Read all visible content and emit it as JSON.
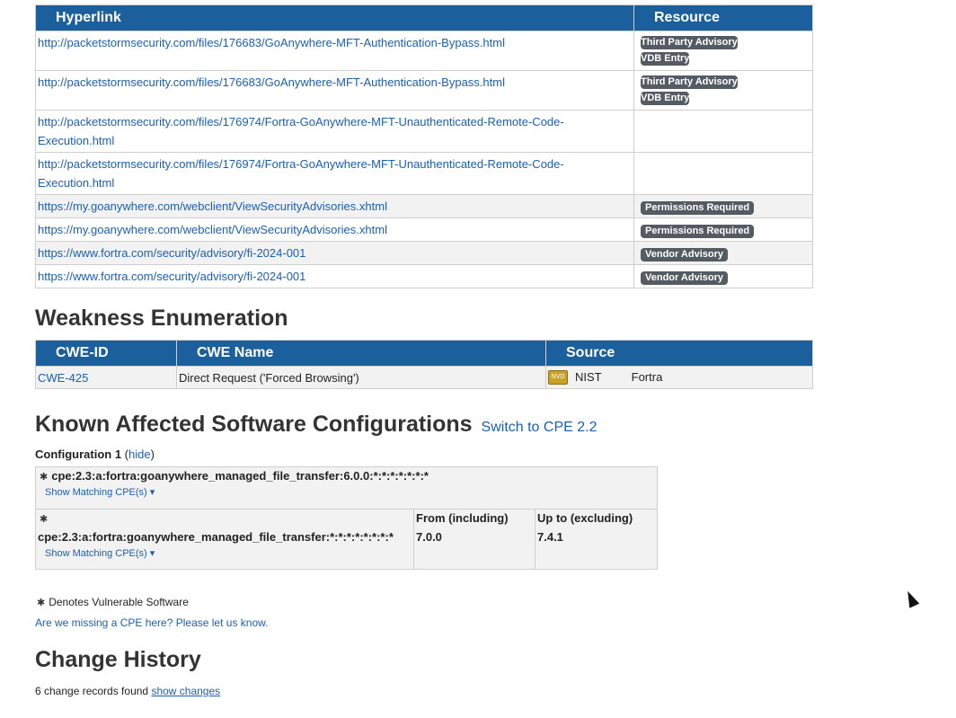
{
  "refs": {
    "col_hyperlink": "Hyperlink",
    "col_resource": "Resource",
    "rows": [
      {
        "url": "http://packetstormsecurity.com/files/176683/GoAnywhere-MFT-Authentication-Bypass.html",
        "badges": [
          "Third Party Advisory",
          "VDB Entry"
        ]
      },
      {
        "url": "http://packetstormsecurity.com/files/176683/GoAnywhere-MFT-Authentication-Bypass.html",
        "badges": [
          "Third Party Advisory",
          "VDB Entry"
        ]
      },
      {
        "url": "http://packetstormsecurity.com/files/176974/Fortra-GoAnywhere-MFT-Unauthenticated-Remote-Code-Execution.html",
        "badges": []
      },
      {
        "url": "http://packetstormsecurity.com/files/176974/Fortra-GoAnywhere-MFT-Unauthenticated-Remote-Code-Execution.html",
        "badges": []
      },
      {
        "url": "https://my.goanywhere.com/webclient/ViewSecurityAdvisories.xhtml",
        "badges": [
          "Permissions Required"
        ]
      },
      {
        "url": "https://my.goanywhere.com/webclient/ViewSecurityAdvisories.xhtml",
        "badges": [
          "Permissions Required"
        ]
      },
      {
        "url": "https://www.fortra.com/security/advisory/fi-2024-001",
        "badges": [
          "Vendor Advisory"
        ]
      },
      {
        "url": "https://www.fortra.com/security/advisory/fi-2024-001",
        "badges": [
          "Vendor Advisory"
        ]
      }
    ]
  },
  "weakness": {
    "title": "Weakness Enumeration",
    "col_id": "CWE-ID",
    "col_name": "CWE Name",
    "col_source": "Source",
    "row": {
      "id": "CWE-425",
      "name": "Direct Request ('Forced Browsing')",
      "source1": "NIST",
      "source2": "Fortra",
      "nist_icon_text": "NVD"
    }
  },
  "known": {
    "title": "Known Affected Software Configurations",
    "switch_link": "Switch to CPE 2.2",
    "config_label": "Configuration 1",
    "hide_paren_open": "(",
    "hide_link": "hide",
    "hide_paren_close": ")",
    "cpe1": "cpe:2.3:a:fortra:goanywhere_managed_file_transfer:6.0.0:*:*:*:*:*:*:*",
    "cpe2": "cpe:2.3:a:fortra:goanywhere_managed_file_transfer:*:*:*:*:*:*:*:*",
    "show_matching": "Show Matching CPE(s)",
    "from_label": "From (including)",
    "from_value": "7.0.0",
    "upto_label": "Up to (excluding)",
    "upto_value": "7.4.1",
    "denotes": "Denotes Vulnerable Software",
    "missing": "Are we missing a CPE here? Please let us know."
  },
  "change": {
    "title": "Change History",
    "count_text": "6 change records found",
    "show_link": "show changes"
  }
}
